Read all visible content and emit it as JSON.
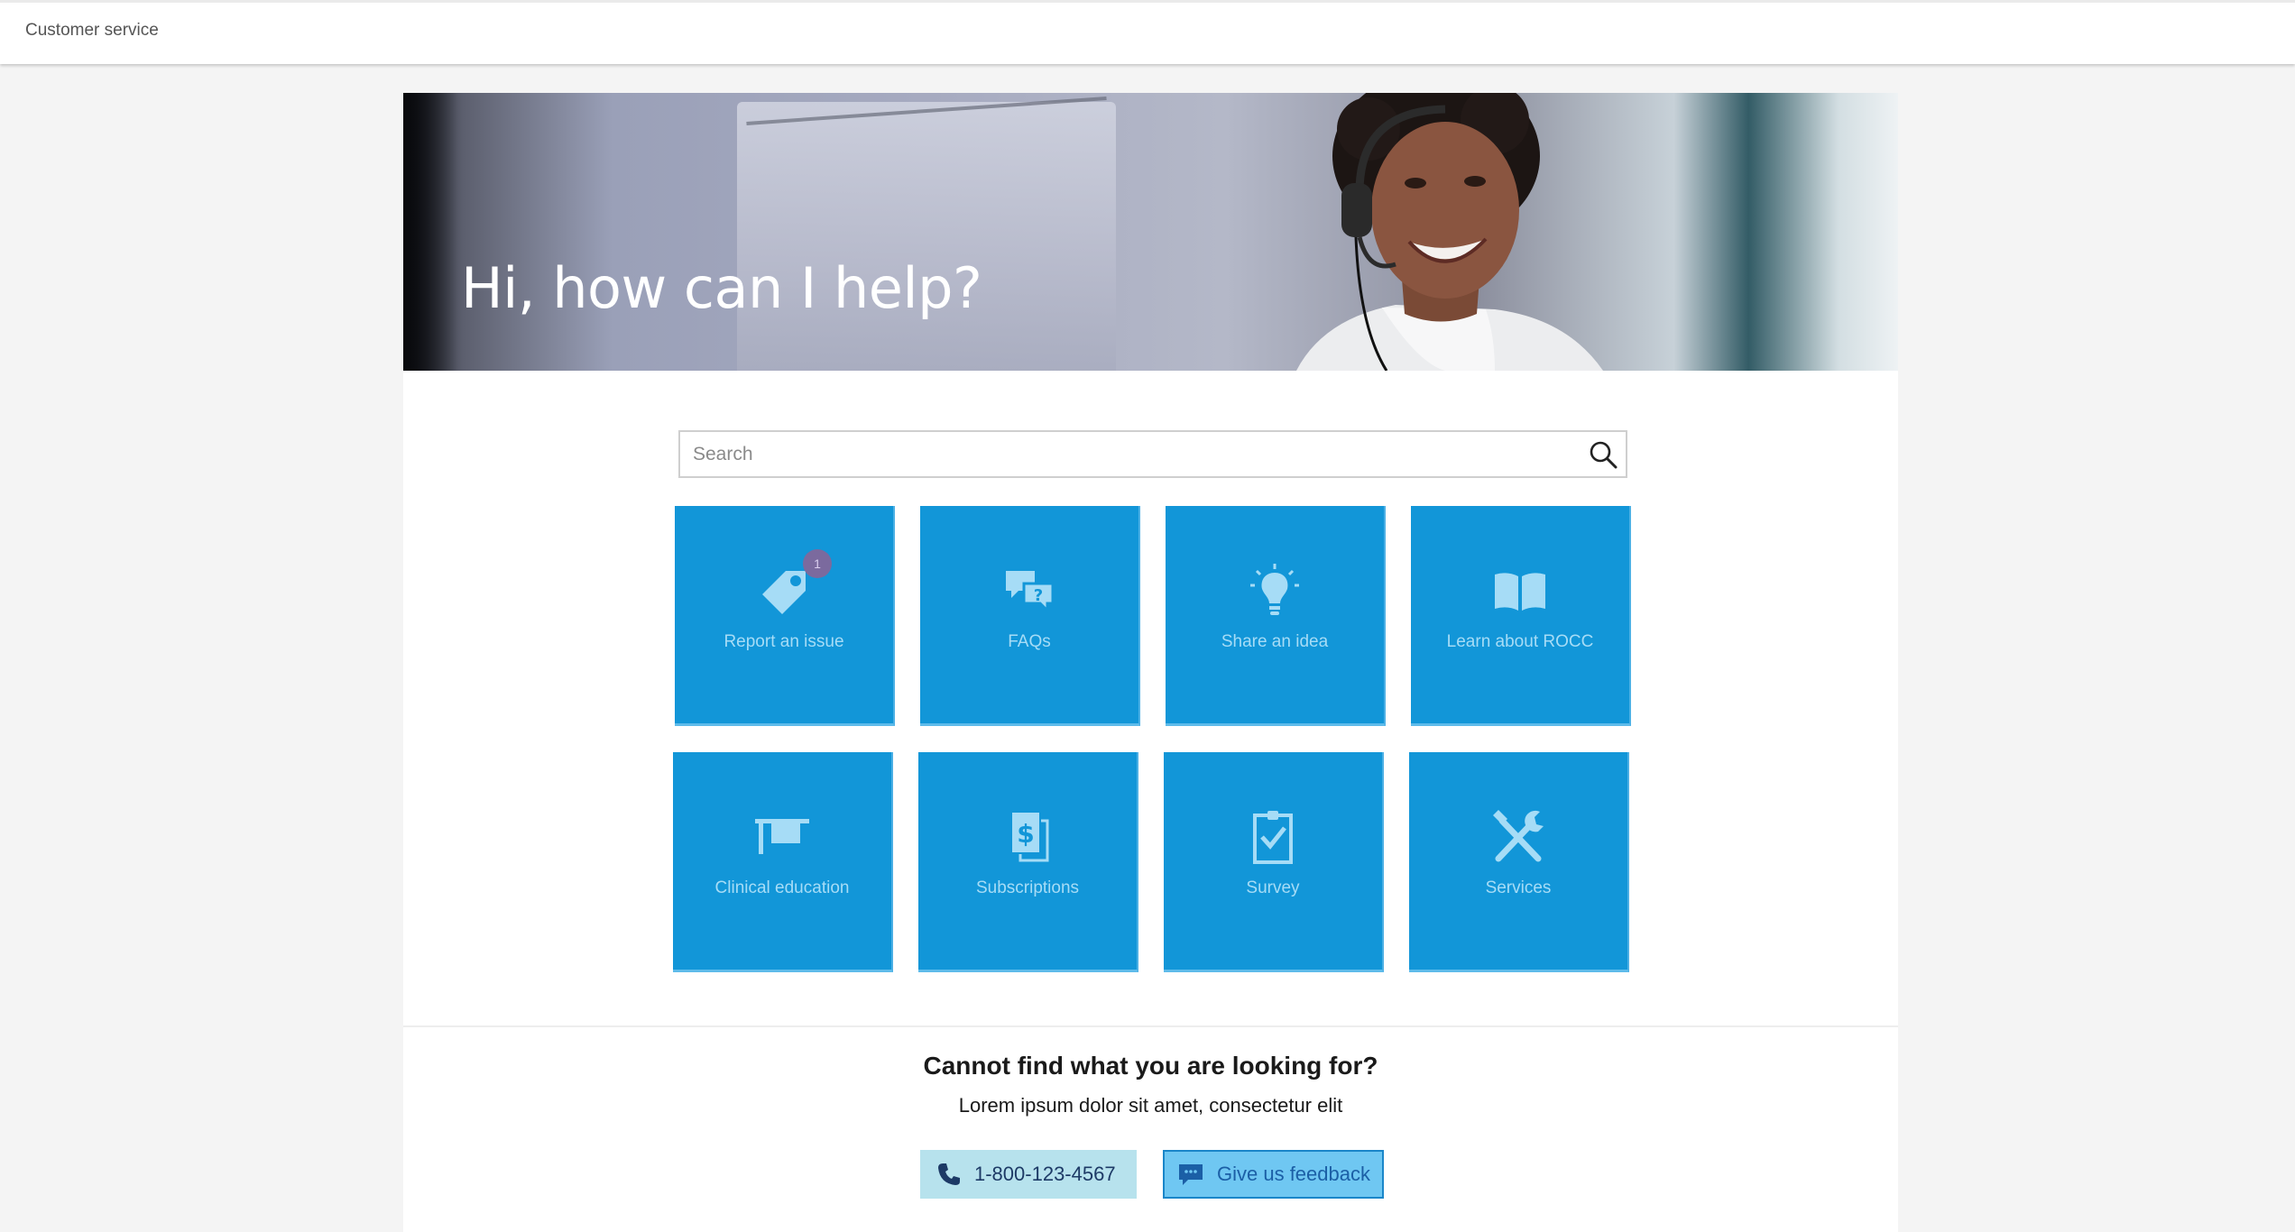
{
  "header": {
    "title": "Customer service"
  },
  "hero": {
    "heading": "Hi, how can I help?"
  },
  "search": {
    "placeholder": "Search",
    "value": ""
  },
  "tiles": [
    {
      "label": "Report an issue",
      "icon": "tag-icon",
      "badge": "1"
    },
    {
      "label": "FAQs",
      "icon": "chat-question-icon"
    },
    {
      "label": "Share an idea",
      "icon": "lightbulb-icon"
    },
    {
      "label": "Learn about ROCC",
      "icon": "book-icon"
    },
    {
      "label": "Clinical education",
      "icon": "graduation-cap-icon"
    },
    {
      "label": "Subscriptions",
      "icon": "billing-documents-icon"
    },
    {
      "label": "Survey",
      "icon": "clipboard-check-icon"
    },
    {
      "label": "Services",
      "icon": "tools-icon"
    }
  ],
  "help": {
    "title": "Cannot find what you are looking for?",
    "subtitle": "Lorem ipsum dolor sit amet, consectetur elit",
    "phone_label": "1-800-123-4567",
    "feedback_label": "Give us feedback"
  },
  "colors": {
    "tile_bg": "#1296d8",
    "tile_text": "#a6dcf6",
    "badge_bg": "#7b6a9e",
    "phone_button_bg": "#b7e2ed",
    "feedback_button_bg": "#6fc7f2"
  }
}
